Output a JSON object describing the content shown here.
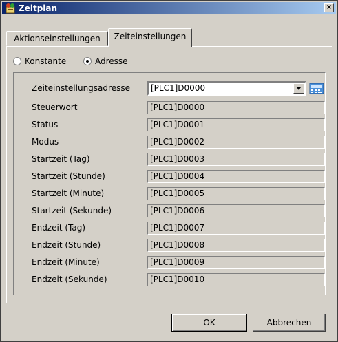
{
  "window": {
    "title": "Zeitplan",
    "close_glyph": "×"
  },
  "tabs": [
    {
      "label": "Aktionseinstellungen",
      "active": false
    },
    {
      "label": "Zeiteinstellungen",
      "active": true
    }
  ],
  "mode": {
    "options": [
      "Konstante",
      "Adresse"
    ],
    "selected": "Adresse"
  },
  "settings": {
    "address_label": "Zeiteinstellungsadresse",
    "address_value": "[PLC1]D0000",
    "rows": [
      {
        "label": "Steuerwort",
        "value": "[PLC1]D0000"
      },
      {
        "label": "Status",
        "value": "[PLC1]D0001"
      },
      {
        "label": "Modus",
        "value": "[PLC1]D0002"
      },
      {
        "label": "Startzeit (Tag)",
        "value": "[PLC1]D0003"
      },
      {
        "label": "Startzeit (Stunde)",
        "value": "[PLC1]D0004"
      },
      {
        "label": "Startzeit (Minute)",
        "value": "[PLC1]D0005"
      },
      {
        "label": "Startzeit (Sekunde)",
        "value": "[PLC1]D0006"
      },
      {
        "label": "Endzeit (Tag)",
        "value": "[PLC1]D0007"
      },
      {
        "label": "Endzeit (Stunde)",
        "value": "[PLC1]D0008"
      },
      {
        "label": "Endzeit (Minute)",
        "value": "[PLC1]D0009"
      },
      {
        "label": "Endzeit (Sekunde)",
        "value": "[PLC1]D0010"
      }
    ]
  },
  "buttons": {
    "ok": "OK",
    "cancel": "Abbrechen"
  }
}
